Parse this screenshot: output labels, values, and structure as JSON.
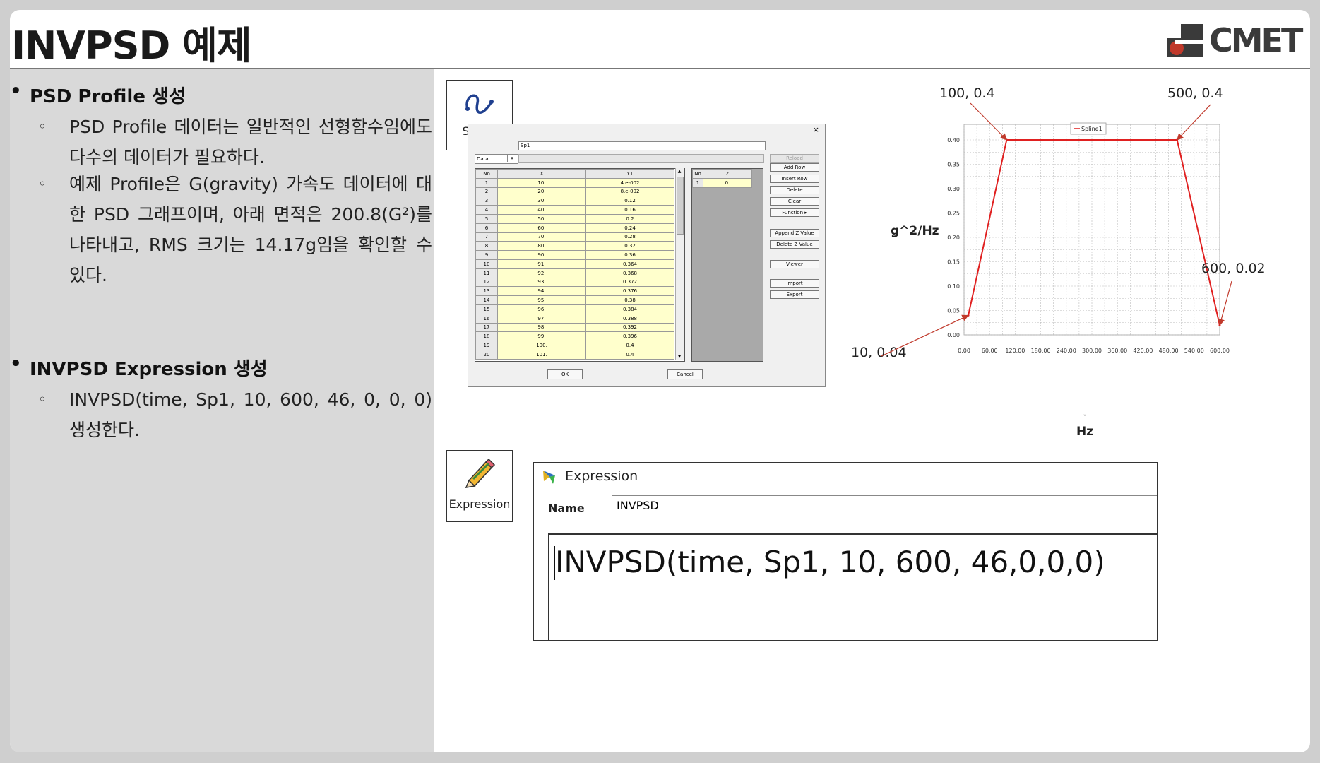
{
  "title": "INVPSD 예제",
  "logo": {
    "text": "CMET"
  },
  "sections": [
    {
      "heading": "PSD Profile 생성",
      "items": [
        "PSD Profile 데이터는 일반적인 선형함수임에도 다수의 데이터가 필요하다.",
        "예제 Profile은 G(gravity) 가속도 데이터에 대한 PSD 그래프이며, 아래 면적은 200.8(G²)를 나타내고, RMS 크기는 14.17g임을 확인할 수 있다."
      ]
    },
    {
      "heading": "INVPSD Expression 생성",
      "items": [
        "INVPSD(time, Sp1, 10, 600, 46, 0, 0, 0) 생성한다."
      ]
    }
  ],
  "spline_icon": {
    "label": "Spline",
    "icon": "spline-curve-icon"
  },
  "expression_icon": {
    "label": "Expression",
    "icon": "pencil-icon"
  },
  "spline_dialog": {
    "close": "×",
    "name_value": "Sp1",
    "data_select": "Data",
    "reload_label": "Reload",
    "columns": [
      "No",
      "X",
      "Y1"
    ],
    "rows": [
      [
        "1",
        "10.",
        "4.e-002"
      ],
      [
        "2",
        "20.",
        "8.e-002"
      ],
      [
        "3",
        "30.",
        "0.12"
      ],
      [
        "4",
        "40.",
        "0.16"
      ],
      [
        "5",
        "50.",
        "0.2"
      ],
      [
        "6",
        "60.",
        "0.24"
      ],
      [
        "7",
        "70.",
        "0.28"
      ],
      [
        "8",
        "80.",
        "0.32"
      ],
      [
        "9",
        "90.",
        "0.36"
      ],
      [
        "10",
        "91.",
        "0.364"
      ],
      [
        "11",
        "92.",
        "0.368"
      ],
      [
        "12",
        "93.",
        "0.372"
      ],
      [
        "13",
        "94.",
        "0.376"
      ],
      [
        "14",
        "95.",
        "0.38"
      ],
      [
        "15",
        "96.",
        "0.384"
      ],
      [
        "16",
        "97.",
        "0.388"
      ],
      [
        "17",
        "98.",
        "0.392"
      ],
      [
        "18",
        "99.",
        "0.396"
      ],
      [
        "19",
        "100.",
        "0.4"
      ],
      [
        "20",
        "101.",
        "0.4"
      ]
    ],
    "z_columns": [
      "No",
      "Z"
    ],
    "z_rows": [
      [
        "1",
        "0."
      ]
    ],
    "buttons": [
      "Add Row",
      "Insert Row",
      "Delete",
      "Clear",
      "Function",
      "Append Z Value",
      "Delete Z Value",
      "Viewer",
      "Import",
      "Export"
    ],
    "ok_label": "OK",
    "cancel_label": "Cancel"
  },
  "chart_data": {
    "type": "line",
    "series": [
      {
        "name": "Spline1",
        "color": "#e02020",
        "x": [
          10,
          100,
          500,
          600
        ],
        "y": [
          0.04,
          0.4,
          0.4,
          0.02
        ]
      }
    ],
    "xlabel": "Hz",
    "ylabel": "g^2/Hz",
    "xlim": [
      0,
      600
    ],
    "ylim": [
      0,
      0.4
    ],
    "xticks": [
      "0.00",
      "60.00",
      "120.00",
      "180.00",
      "240.00",
      "300.00",
      "360.00",
      "420.00",
      "480.00",
      "540.00",
      "600.00"
    ],
    "yticks": [
      "0.00",
      "0.05",
      "0.10",
      "0.15",
      "0.20",
      "0.25",
      "0.30",
      "0.35",
      "0.40"
    ],
    "grid": true,
    "legend": "top-center",
    "annotations": [
      {
        "text": "100, 0.4",
        "x": 100,
        "y": 0.4
      },
      {
        "text": "500, 0.4",
        "x": 500,
        "y": 0.4
      },
      {
        "text": "600, 0.02",
        "x": 600,
        "y": 0.02
      },
      {
        "text": "10, 0.04",
        "x": 10,
        "y": 0.04
      }
    ]
  },
  "expression_window": {
    "title": "Expression",
    "name_label": "Name",
    "name_value": "INVPSD",
    "expression": "INVPSD(time, Sp1, 10, 600, 46,0,0,0)"
  }
}
